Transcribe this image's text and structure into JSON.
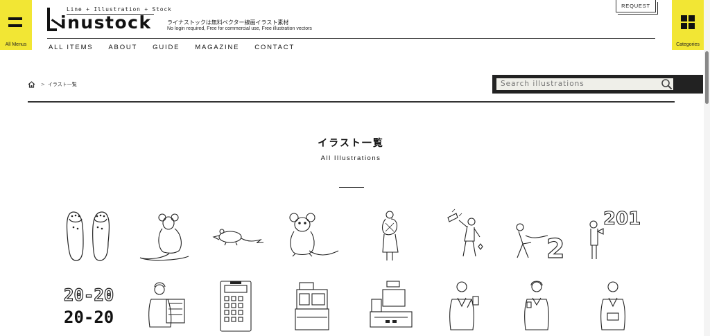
{
  "header": {
    "menu_label": "All Menus",
    "categories_label": "Categories",
    "tagline_top": "Line + Illustration + Stock",
    "logo_text": "inustock",
    "tagline_jp": "ライナストックは無料ベクター線画イラスト素材",
    "tagline_en": "No login required, Free for commercial use, Free illustration vectors",
    "request_label": "REQUEST"
  },
  "nav": {
    "items": [
      "ALL ITEMS",
      "ABOUT",
      "GUIDE",
      "MAGAZINE",
      "CONTACT"
    ]
  },
  "breadcrumb": {
    "separator": ">",
    "current": "イラスト一覧"
  },
  "search": {
    "placeholder": "Search illustrations"
  },
  "page": {
    "title": "イラスト一覧",
    "subtitle": "All Illustrations"
  },
  "illustrations": [
    {
      "icon": "sandals-icon"
    },
    {
      "icon": "rat-back-icon"
    },
    {
      "icon": "mouse-side-icon"
    },
    {
      "icon": "rat-front-icon"
    },
    {
      "icon": "woman-carrying-icon"
    },
    {
      "icon": "man-celebrating-icon"
    },
    {
      "icon": "man-pulling-two-icon"
    },
    {
      "icon": "man-megaphone-2019-icon"
    },
    {
      "icon": "year-2020-text-icon"
    },
    {
      "icon": "woman-calculator-icon"
    },
    {
      "icon": "calculator-icon"
    },
    {
      "icon": "cash-register-icon"
    },
    {
      "icon": "pos-register-icon"
    },
    {
      "icon": "businessman-phone-icon"
    },
    {
      "icon": "businesswoman-icon"
    },
    {
      "icon": "businessman-tablet-icon"
    }
  ],
  "colors": {
    "accent": "#f2e634",
    "dark": "#222222"
  }
}
